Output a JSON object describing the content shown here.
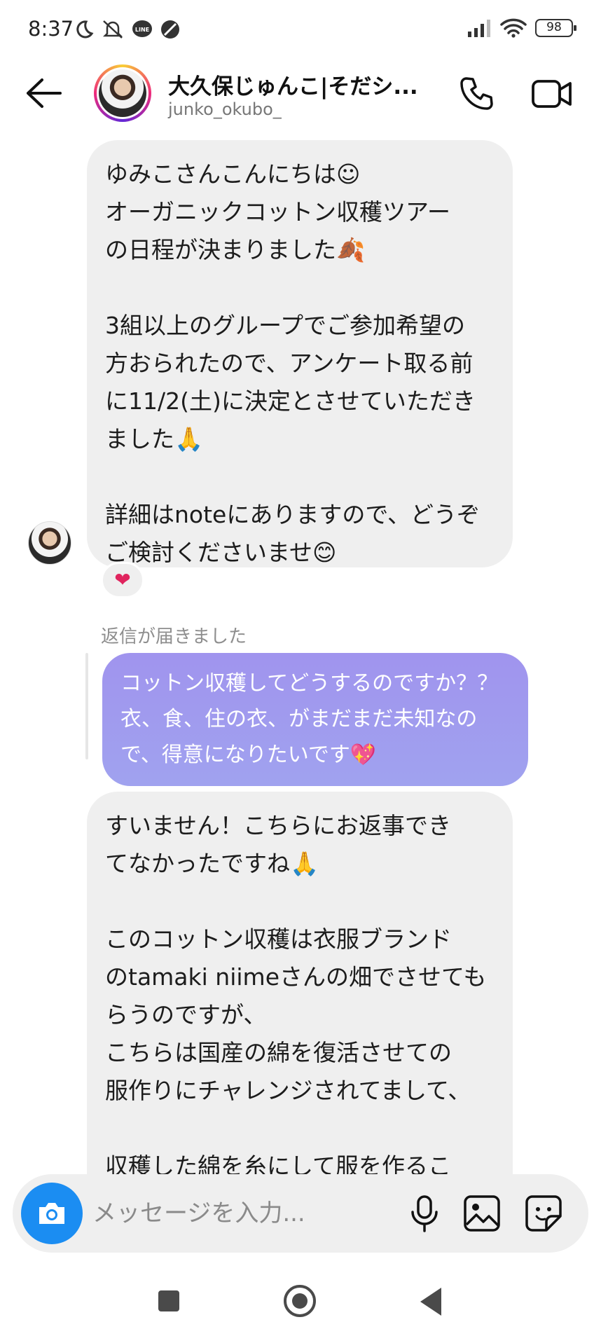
{
  "status_bar": {
    "time": "8:37",
    "battery": "98",
    "icons": [
      "moon-icon",
      "bell-mute-icon",
      "line-icon",
      "dnd-icon",
      "signal-icon",
      "wifi-icon",
      "battery-icon"
    ]
  },
  "header": {
    "name": "大久保じゅんこ|そだシ...",
    "username": "junko_okubo_"
  },
  "messages": {
    "m1": "ゆみこさんこんにちは☺\nオーガニックコットン収穫ツアー\nの日程が決まりました🍂\n\n3組以上のグループでご参加希望の\n方おられたので、アンケート取る前\nに11/2(土)に決定とさせていただき\nました🙏\n\n詳細はnoteにありますので、どうぞ\nご検討くださいませ😊",
    "reaction": "❤",
    "reply_label": "返信が届きました",
    "reply": "コットン収穫してどうするのですか？？\n衣、食、住の衣、がまだまだ未知なの\nで、得意になりたいです💖",
    "m2": "すいません！こちらにお返事でき\nてなかったですね🙏\n\nこのコットン収穫は衣服ブランド\nのtamaki niimeさんの畑でさせても\nらうのですが、\nこちらは国産の綿を復活させての\n服作りにチャレンジされてまして、\n\n収穫した綿を糸にして服を作るこ\nとを目指されています"
  },
  "composer": {
    "placeholder": "メッセージを入力..."
  },
  "colors": {
    "accent": "#1b8df2",
    "bubble_received": "#efefef",
    "bubble_sent_gradient": [
      "#a094ee",
      "#a0a2ef"
    ]
  }
}
